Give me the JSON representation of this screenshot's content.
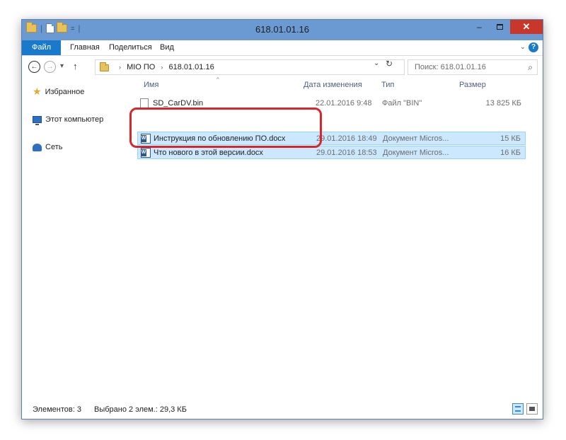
{
  "window": {
    "title": "618.01.01.16",
    "qat_separator": "|",
    "qat_dropdown": "=",
    "minimize_glyph": "–",
    "close_glyph": "✕"
  },
  "ribbon": {
    "tabs": [
      "Файл",
      "Главная",
      "Поделиться",
      "Вид"
    ],
    "expand_glyph": "⌄",
    "help_glyph": "?"
  },
  "nav": {
    "back_glyph": "←",
    "forward_glyph": "→",
    "recent_glyph": "▾",
    "up_glyph": "↑",
    "breadcrumb": [
      "MIO ПО",
      "618.01.01.16"
    ],
    "breadcrumb_arrow": "›",
    "address_dropdown_glyph": "⌄",
    "refresh_glyph": "↻",
    "search_placeholder": "Поиск: 618.01.01.16",
    "search_glyph": "⌕"
  },
  "sidebar": {
    "items": [
      {
        "label": "Избранное",
        "icon": "star-icon"
      },
      {
        "label": "Этот компьютер",
        "icon": "computer-icon"
      },
      {
        "label": "Сеть",
        "icon": "network-icon"
      }
    ]
  },
  "columns": {
    "name": "Имя",
    "date": "Дата изменения",
    "type": "Тип",
    "size": "Размер",
    "sort_glyph": "^"
  },
  "files": [
    {
      "name": "SD_CarDV.bin",
      "date": "22.01.2016 9:48",
      "type": "Файл \"BIN\"",
      "size": "13 825 КБ",
      "selected": false,
      "icon": "file-icon"
    },
    {
      "name": "Инструкция по обновлению ПО.docx",
      "date": "29.01.2016 18:49",
      "type": "Документ Micros...",
      "size": "15 КБ",
      "selected": true,
      "icon": "word-document-icon"
    },
    {
      "name": "Что нового в этой версии.docx",
      "date": "29.01.2016 18:53",
      "type": "Документ Micros...",
      "size": "16 КБ",
      "selected": true,
      "icon": "word-document-icon"
    }
  ],
  "status": {
    "items_count": "Элементов: 3",
    "selected": "Выбрано 2 элем.: 29,3 КБ"
  },
  "colors": {
    "titlebar": "#6b9ad3",
    "file_tab": "#1979ca",
    "close_button": "#c7382b",
    "selection": "#cce8ff",
    "highlight_border": "#d9262b"
  }
}
